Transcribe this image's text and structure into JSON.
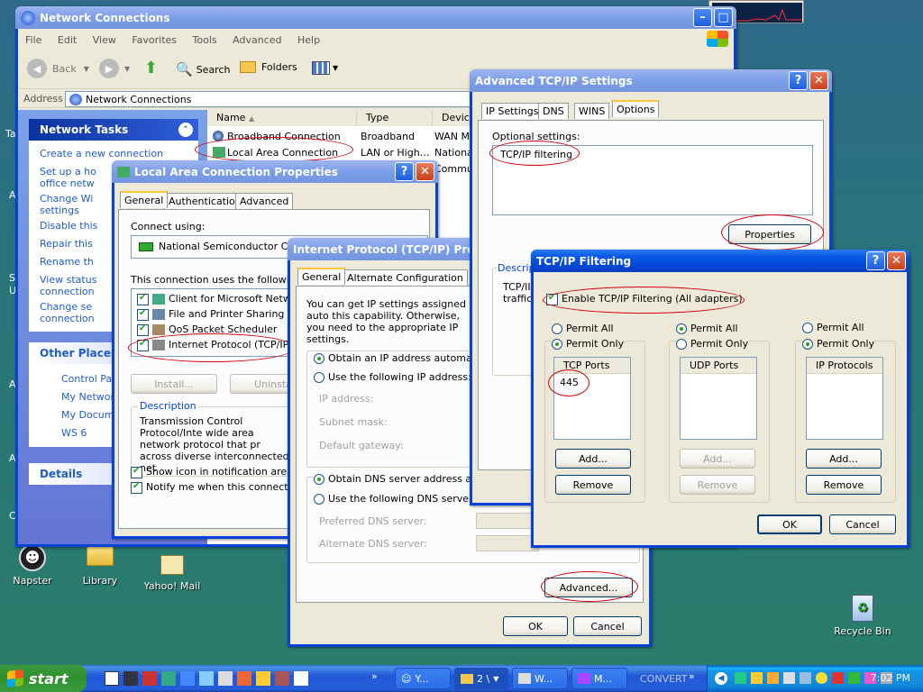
{
  "desktop": {
    "icons": [
      {
        "label": "Napster"
      },
      {
        "label": "Library"
      },
      {
        "label": "Yahoo! Mail"
      },
      {
        "label": "Recycle Bin"
      }
    ],
    "edge_letters": [
      "Ta",
      "A",
      "Sl",
      "U",
      "A",
      "A",
      "C"
    ]
  },
  "explorer": {
    "title": "Network Connections",
    "menu": [
      "File",
      "Edit",
      "View",
      "Favorites",
      "Tools",
      "Advanced",
      "Help"
    ],
    "toolbar": {
      "back": "Back",
      "search": "Search",
      "folders": "Folders"
    },
    "address_label": "Address",
    "address_value": "Network Connections",
    "columns": [
      "Name",
      "Type",
      "Device"
    ],
    "rows": [
      {
        "name": "Broadband Connection",
        "type": "Broadband",
        "device": "WAN Mi"
      },
      {
        "name": "Local Area Connection",
        "type": "LAN or High…",
        "device": "Nationa"
      },
      {
        "name": "",
        "type": "",
        "device": "Commun"
      }
    ],
    "network_tasks": {
      "title": "Network Tasks",
      "items": [
        "Create a new connection",
        "Set up a ho",
        "office netw",
        "Change Wi",
        "settings",
        "Disable this",
        "Repair this",
        "Rename th",
        "View status",
        "connection",
        "Change se",
        "connection"
      ]
    },
    "other_places": {
      "title": "Other Places",
      "items": [
        "Control Pa",
        "My Networ",
        "My Docume",
        "WS 6"
      ]
    },
    "details": {
      "title": "Details"
    }
  },
  "lac_props": {
    "title": "Local Area Connection Properties",
    "tabs": [
      "General",
      "Authentication",
      "Advanced"
    ],
    "connect_using": "Connect using:",
    "adapter": "National Semiconductor Corp.",
    "uses_label": "This connection uses the following it",
    "items": [
      "Client for Microsoft Network",
      "File and Printer Sharing for M",
      "QoS Packet Scheduler",
      "Internet Protocol (TCP/IP)"
    ],
    "install": "Install...",
    "uninstall": "Uninsta",
    "description_title": "Description",
    "description": "Transmission Control Protocol/Inte wide area network protocol that pr across diverse interconnected net",
    "show_icon": "Show icon in notification area whe",
    "notify": "Notify me when this connection h"
  },
  "tcpip_props": {
    "title": "Internet Protocol (TCP/IP) Prope",
    "tabs": [
      "General",
      "Alternate Configuration"
    ],
    "intro": "You can get IP settings assigned auto this capability. Otherwise, you need to the appropriate IP settings.",
    "obtain_ip": "Obtain an IP address automatica",
    "use_ip": "Use the following IP address:",
    "ip_label": "IP address:",
    "mask_label": "Subnet mask:",
    "gateway_label": "Default gateway:",
    "obtain_dns": "Obtain DNS server address auto",
    "use_dns": "Use the following DNS server ac",
    "pref_dns": "Preferred DNS server:",
    "alt_dns": "Alternate DNS server:",
    "advanced": "Advanced...",
    "ok": "OK",
    "cancel": "Cancel"
  },
  "adv_tcpip": {
    "title": "Advanced TCP/IP Settings",
    "tabs": [
      "IP Settings",
      "DNS",
      "WINS",
      "Options"
    ],
    "optional": "Optional settings:",
    "option_item": "TCP/IP filtering",
    "properties": "Properties",
    "desc_title": "Descrip",
    "desc_text": "TCP/II traffic"
  },
  "filtering": {
    "title": "TCP/IP Filtering",
    "enable": "Enable TCP/IP Filtering (All adapters)",
    "permit_all": "Permit All",
    "permit_only": "Permit Only",
    "tcp_header": "TCP Ports",
    "tcp_ports": [
      "445"
    ],
    "udp_header": "UDP Ports",
    "ip_header": "IP Protocols",
    "add": "Add...",
    "remove": "Remove",
    "ok": "OK",
    "cancel": "Cancel"
  },
  "taskbar": {
    "start": "start",
    "tasks": [
      "Y...",
      "2 \\",
      "W...",
      "M..."
    ],
    "convert": "CONVERT",
    "clock": "7:02 PM"
  },
  "colors": {
    "accent": "#0842d9",
    "highlight": "#d4000a",
    "desktop": "#2a7d6b"
  }
}
